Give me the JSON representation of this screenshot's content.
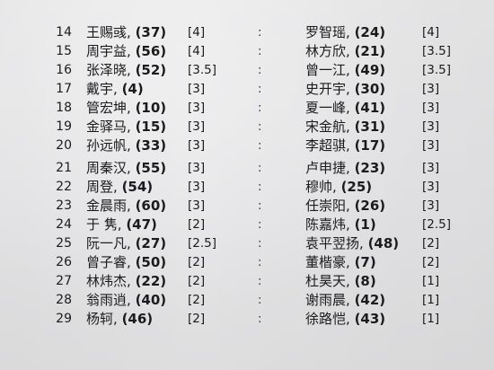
{
  "pairings": {
    "group1": [
      {
        "no": "14",
        "white_name": "王赐彧,",
        "white_rating": "(37)",
        "white_points": "[4]",
        "separator": ":",
        "black_name": "罗智瑶,",
        "black_rating": "(24)",
        "black_points": "[4]"
      },
      {
        "no": "15",
        "white_name": "周宇益,",
        "white_rating": "(56)",
        "white_points": "[4]",
        "separator": ":",
        "black_name": "林方欣,",
        "black_rating": "(21)",
        "black_points": "[3.5]"
      },
      {
        "no": "16",
        "white_name": "张泽晓,",
        "white_rating": "(52)",
        "white_points": "[3.5]",
        "separator": ":",
        "black_name": "曾一江,",
        "black_rating": "(49)",
        "black_points": "[3.5]"
      },
      {
        "no": "17",
        "white_name": "戴宇,",
        "white_rating": "(4)",
        "white_points": "[3]",
        "separator": ":",
        "black_name": "史开宇,",
        "black_rating": "(30)",
        "black_points": "[3]"
      },
      {
        "no": "18",
        "white_name": "管宏坤,",
        "white_rating": "(10)",
        "white_points": "[3]",
        "separator": ":",
        "black_name": "夏一峰,",
        "black_rating": "(41)",
        "black_points": "[3]"
      },
      {
        "no": "19",
        "white_name": "金驿马,",
        "white_rating": "(15)",
        "white_points": "[3]",
        "separator": ":",
        "black_name": "宋金航,",
        "black_rating": "(31)",
        "black_points": "[3]"
      },
      {
        "no": "20",
        "white_name": "孙远帆,",
        "white_rating": "(33)",
        "white_points": "[3]",
        "separator": ":",
        "black_name": "李超骐,",
        "black_rating": "(17)",
        "black_points": "[3]"
      }
    ],
    "group2": [
      {
        "no": "21",
        "white_name": "周秦汉,",
        "white_rating": "(55)",
        "white_points": "[3]",
        "separator": ":",
        "black_name": "卢申捷,",
        "black_rating": "(23)",
        "black_points": "[3]"
      },
      {
        "no": "22",
        "white_name": "周登,",
        "white_rating": "(54)",
        "white_points": "[3]",
        "separator": ":",
        "black_name": "穆帅,",
        "black_rating": "(25)",
        "black_points": "[3]"
      },
      {
        "no": "23",
        "white_name": "金晨雨,",
        "white_rating": "(60)",
        "white_points": "[3]",
        "separator": ":",
        "black_name": "任崇阳,",
        "black_rating": "(26)",
        "black_points": "[3]"
      },
      {
        "no": "24",
        "white_name": "于 隽,",
        "white_rating": "(47)",
        "white_points": "[2]",
        "separator": ":",
        "black_name": "陈嘉炜,",
        "black_rating": "(1)",
        "black_points": "[2.5]"
      },
      {
        "no": "25",
        "white_name": "阮一凡,",
        "white_rating": "(27)",
        "white_points": "[2.5]",
        "separator": ":",
        "black_name": "袁平翌扬,",
        "black_rating": "(48)",
        "black_points": "[2]"
      },
      {
        "no": "26",
        "white_name": "曾子睿,",
        "white_rating": "(50)",
        "white_points": "[2]",
        "separator": ":",
        "black_name": "董楷豪,",
        "black_rating": "(7)",
        "black_points": "[2]"
      },
      {
        "no": "27",
        "white_name": "林炜杰,",
        "white_rating": "(22)",
        "white_points": "[2]",
        "separator": ":",
        "black_name": "杜昊天,",
        "black_rating": "(8)",
        "black_points": "[1]"
      },
      {
        "no": "28",
        "white_name": "翁雨逍,",
        "white_rating": "(40)",
        "white_points": "[2]",
        "separator": ":",
        "black_name": "谢雨晨,",
        "black_rating": "(42)",
        "black_points": "[1]"
      },
      {
        "no": "29",
        "white_name": "杨轲,",
        "white_rating": "(46)",
        "white_points": "[2]",
        "separator": ":",
        "black_name": "徐路恺,",
        "black_rating": "(43)",
        "black_points": "[1]"
      }
    ]
  }
}
